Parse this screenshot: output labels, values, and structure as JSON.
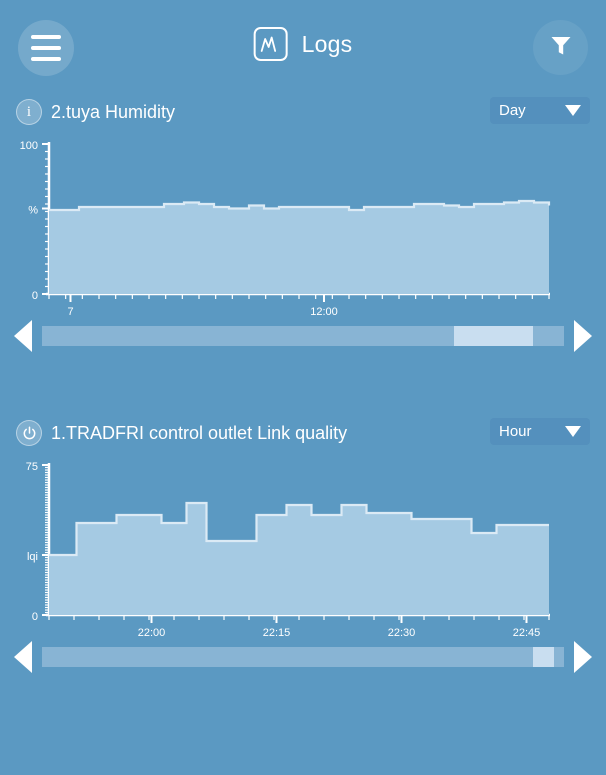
{
  "header": {
    "menu_icon": "hamburger-icon",
    "logo_icon": "logs-chart-icon",
    "title": "Logs",
    "filter_icon": "filter-funnel-icon"
  },
  "charts": [
    {
      "icon": "info-icon",
      "icon_glyph": "i",
      "title": "2.tuya Humidity",
      "range_label": "Day",
      "caret_icon": "chevron-down-icon",
      "scrollbar": {
        "left_icon": "arrow-left-icon",
        "right_icon": "arrow-right-icon",
        "thumb_start_pct": 79,
        "thumb_width_pct": 15
      },
      "chart_data": {
        "type": "area",
        "title": "2.tuya Humidity",
        "xlabel": "",
        "ylabel": "%",
        "ylim": [
          0,
          100
        ],
        "ytick_labels": [
          "100",
          "%",
          "0"
        ],
        "ytick_values": [
          100,
          57,
          0
        ],
        "grid": false,
        "legend": "none",
        "xtick_labels": [
          "7",
          "12:00"
        ],
        "xtick_positions": [
          0.043,
          0.55
        ],
        "x": [
          0.0,
          0.03,
          0.06,
          0.09,
          0.12,
          0.15,
          0.19,
          0.23,
          0.27,
          0.3,
          0.33,
          0.36,
          0.4,
          0.43,
          0.46,
          0.5,
          0.53,
          0.56,
          0.6,
          0.63,
          0.66,
          0.7,
          0.73,
          0.76,
          0.79,
          0.82,
          0.85,
          0.88,
          0.91,
          0.94,
          0.97,
          1.0
        ],
        "values": [
          56,
          56,
          58,
          58,
          58,
          58,
          58,
          60,
          61,
          60,
          58,
          57,
          59,
          57,
          58,
          58,
          58,
          58,
          56,
          58,
          58,
          58,
          60,
          60,
          59,
          58,
          60,
          60,
          61,
          62,
          61,
          59
        ]
      }
    },
    {
      "icon": "power-icon",
      "icon_glyph": "⏻",
      "title": "1.TRADFRI control outlet Link quality",
      "range_label": "Hour",
      "caret_icon": "chevron-down-icon",
      "scrollbar": {
        "left_icon": "arrow-left-icon",
        "right_icon": "arrow-right-icon",
        "thumb_start_pct": 94,
        "thumb_width_pct": 4
      },
      "chart_data": {
        "type": "area",
        "title": "1.TRADFRI control outlet Link quality",
        "xlabel": "",
        "ylabel": "lqi",
        "ylim": [
          0,
          75
        ],
        "ytick_labels": [
          "75",
          "lqi",
          "0"
        ],
        "ytick_values": [
          75,
          30,
          0
        ],
        "grid": false,
        "legend": "none",
        "xtick_labels": [
          "22:00",
          "22:15",
          "22:30",
          "22:45"
        ],
        "xtick_positions": [
          0.205,
          0.455,
          0.705,
          0.955
        ],
        "x": [
          0.0,
          0.055,
          0.135,
          0.225,
          0.275,
          0.315,
          0.365,
          0.415,
          0.475,
          0.525,
          0.585,
          0.635,
          0.685,
          0.725,
          0.79,
          0.845,
          0.895,
          1.0
        ],
        "values": [
          30,
          46,
          50,
          46,
          56,
          37,
          37,
          50,
          55,
          50,
          55,
          51,
          51,
          48,
          48,
          41,
          45,
          45
        ]
      }
    }
  ],
  "colors": {
    "background": "#5b99c2",
    "plot_fill": "#a5cae3",
    "plot_line": "#dbeaf5",
    "axis": "#ffffff",
    "select_bg": "#5490bd",
    "scroll_track": "#88b4d4",
    "scroll_thumb": "#c9def0"
  }
}
